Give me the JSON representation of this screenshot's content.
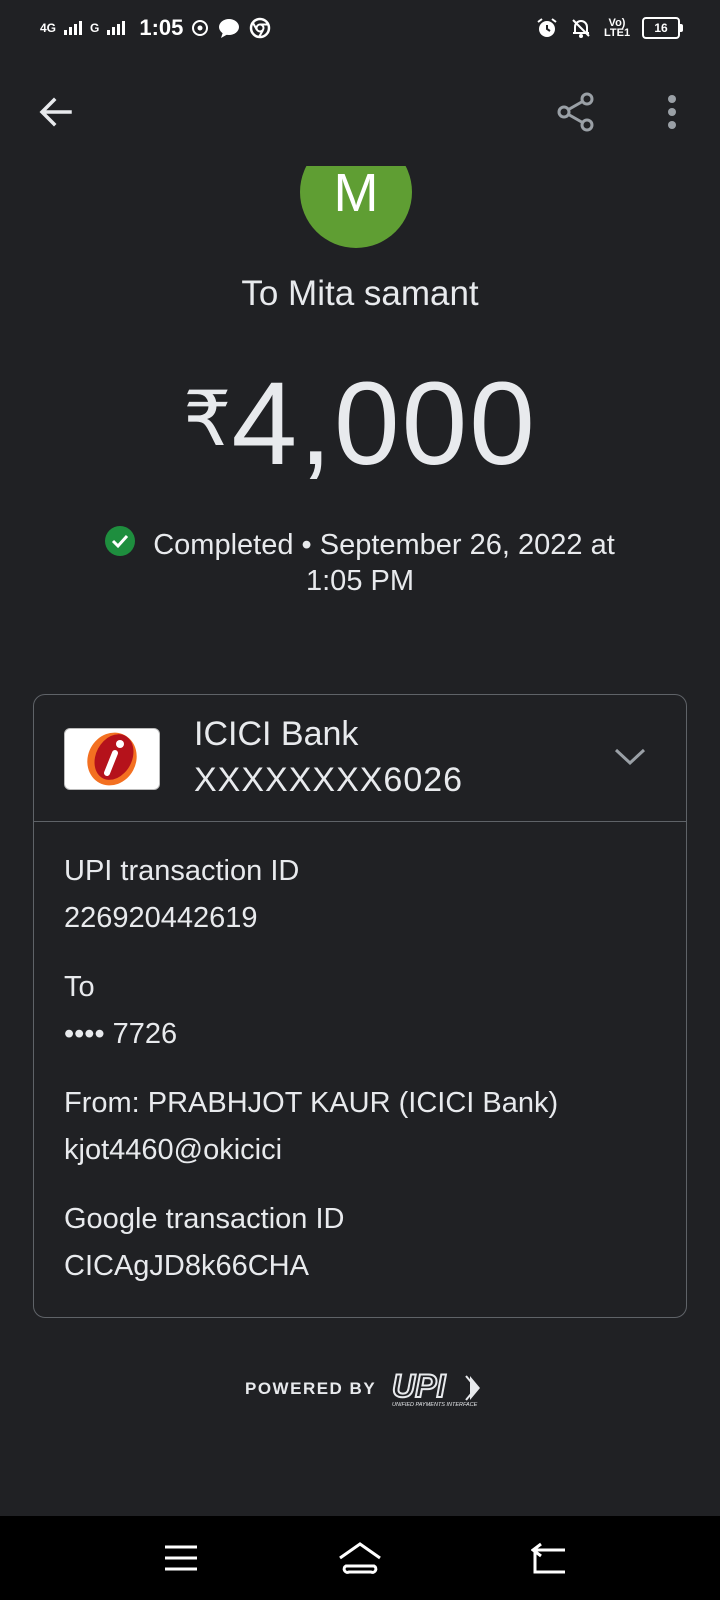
{
  "status_bar": {
    "sim1": "4G",
    "sim2": "G",
    "time": "1:05",
    "volte": "Vo) LTE1",
    "battery": "16"
  },
  "recipient": {
    "avatar_letter": "M",
    "title": "To Mita samant"
  },
  "payment": {
    "currency": "₹",
    "amount": "4,000",
    "status": "Completed",
    "datetime_line1": " • September 26, 2022 at",
    "datetime_line2": "1:05 PM"
  },
  "account": {
    "bank_name": "ICICI Bank",
    "account_number": "XXXXXXXX6026"
  },
  "details": {
    "upi_label": "UPI transaction ID",
    "upi_value": "226920442619",
    "to_label": "To",
    "to_value": "•••• 7726",
    "from_label": "From: PRABHJOT KAUR (ICICI Bank)",
    "from_value": "kjot4460@okicici",
    "google_label": "Google transaction ID",
    "google_value": "CICAgJD8k66CHA"
  },
  "footer": {
    "powered_by": "POWERED BY",
    "upi_logo": "UPI",
    "upi_tagline": "UNIFIED PAYMENTS INTERFACE"
  },
  "colors": {
    "background": "#202124",
    "avatar": "#5f9e33",
    "success": "#1e8e3e",
    "border": "#5f6368"
  },
  "icons": [
    "arrow-back-icon",
    "share-icon",
    "more-vert-icon",
    "chevron-down-icon",
    "check-circle-icon",
    "menu-icon",
    "home-icon",
    "back-nav-icon"
  ]
}
